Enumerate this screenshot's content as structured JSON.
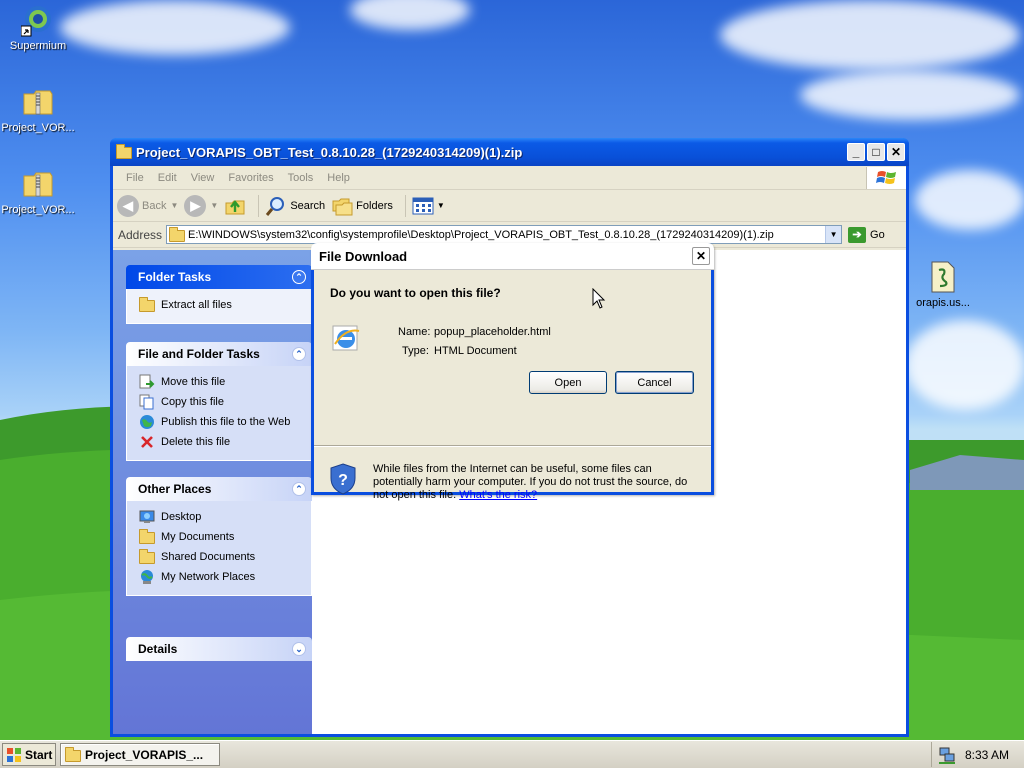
{
  "desktop": {
    "icons": [
      {
        "label": "Supermium",
        "icon": "supermium-browser-icon"
      },
      {
        "label": "Project_VOR...",
        "icon": "zip-folder-icon"
      },
      {
        "label": "Project_VOR...",
        "icon": "zip-folder-icon"
      }
    ]
  },
  "explorer": {
    "title": "Project_VORAPIS_OBT_Test_0.8.10.28_(1729240314209)(1).zip",
    "menu": [
      "File",
      "Edit",
      "View",
      "Favorites",
      "Tools",
      "Help"
    ],
    "toolbar": {
      "back": "Back",
      "search": "Search",
      "folders": "Folders"
    },
    "address": {
      "label": "Address",
      "value": "E:\\WINDOWS\\system32\\config\\systemprofile\\Desktop\\Project_VORAPIS_OBT_Test_0.8.10.28_(1729240314209)(1).zip",
      "go": "Go"
    },
    "left_pane": {
      "folder_tasks": {
        "title": "Folder Tasks",
        "items": [
          "Extract all files"
        ]
      },
      "file_folder_tasks": {
        "title": "File and Folder Tasks",
        "items": [
          "Move this file",
          "Copy this file",
          "Publish this file to the Web",
          "Delete this file"
        ]
      },
      "other_places": {
        "title": "Other Places",
        "items": [
          "Desktop",
          "My Documents",
          "Shared Documents",
          "My Network Places"
        ]
      },
      "details": {
        "title": "Details"
      }
    },
    "file_label": "orapis.us..."
  },
  "dialog": {
    "title": "File Download",
    "question": "Do you want to open this file?",
    "name_label": "Name:",
    "name_value": "popup_placeholder.html",
    "type_label": "Type:",
    "type_value": "HTML Document",
    "open_button": "Open",
    "cancel_button": "Cancel",
    "warning": "While files from the Internet can be useful, some files can potentially harm your computer. If you do not trust the source, do not open this file.",
    "risk_link": "What's the risk?"
  },
  "taskbar": {
    "start": "Start",
    "task": "Project_VORAPIS_...",
    "clock": "8:33 AM"
  }
}
